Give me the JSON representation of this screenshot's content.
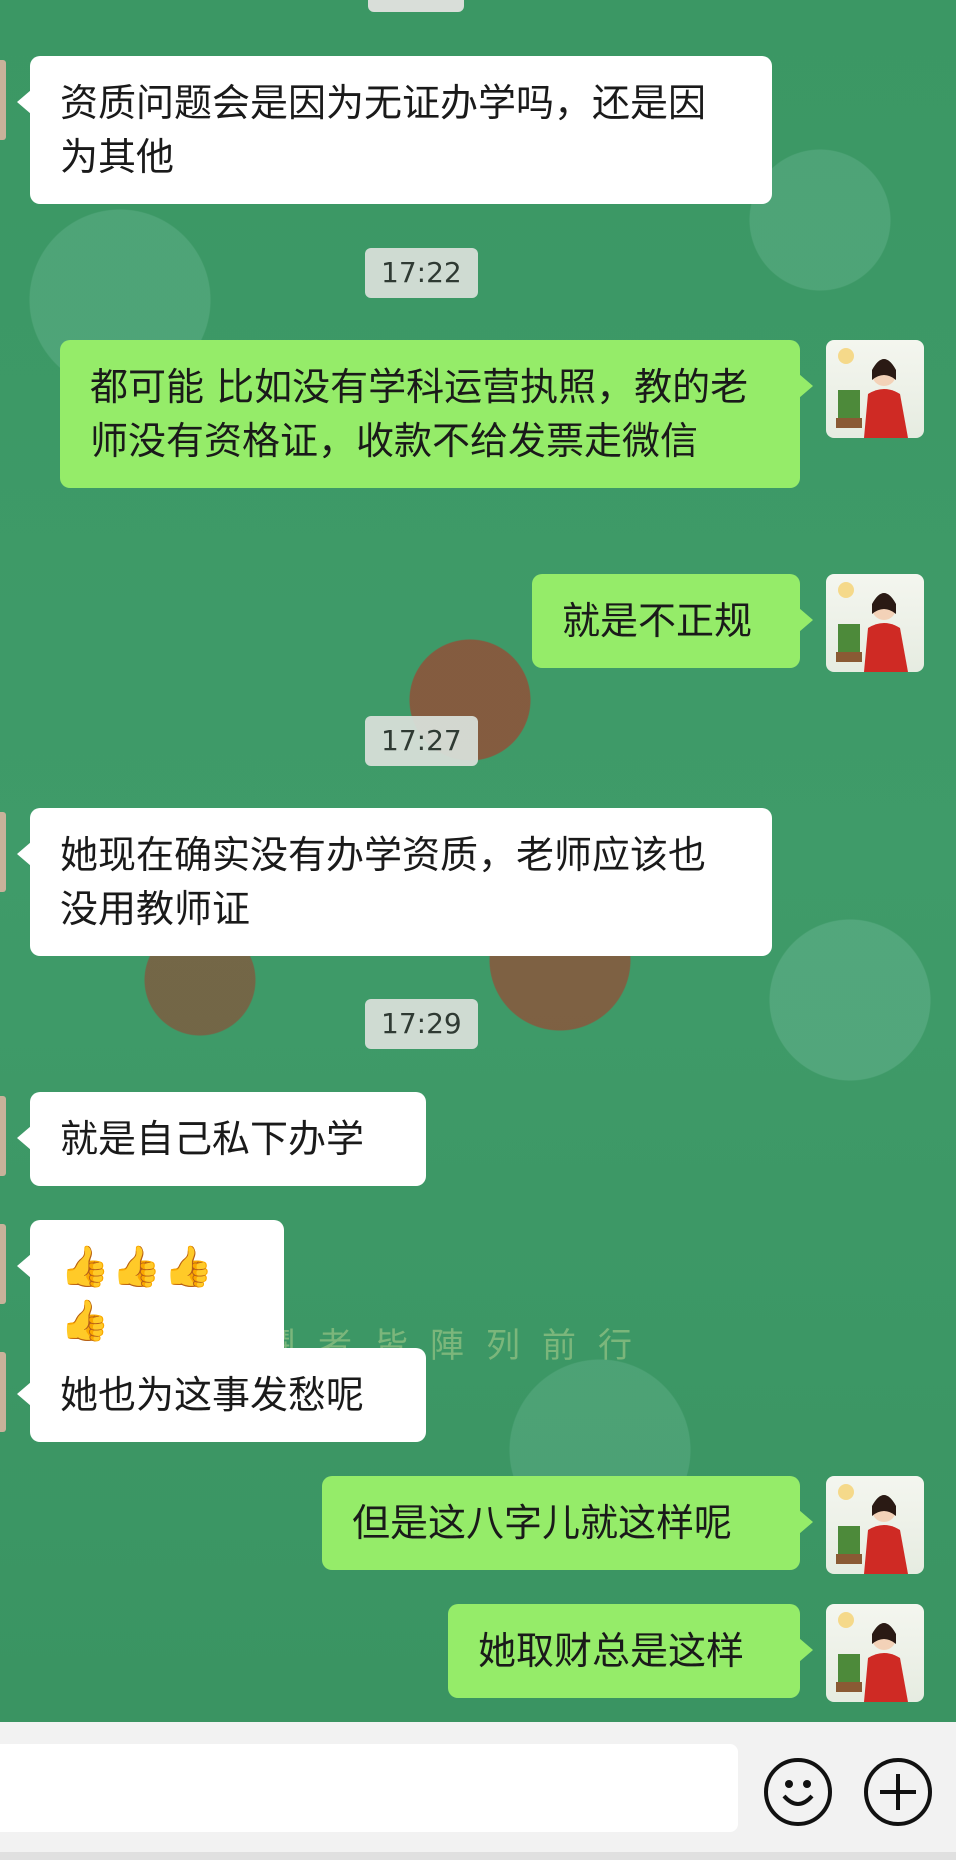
{
  "messages": [
    {
      "side": "left",
      "text": "资质问题会是因为无证办学吗，还是因为其他"
    },
    {
      "time": "17:22"
    },
    {
      "side": "right",
      "text": "都可能  比如没有学科运营执照，教的老师没有资格证，收款不给发票走微信"
    },
    {
      "side": "right",
      "text": "就是不正规"
    },
    {
      "time": "17:27"
    },
    {
      "side": "left",
      "text": "她现在确实没有办学资质，老师应该也没用教师证"
    },
    {
      "time": "17:29"
    },
    {
      "side": "left",
      "text": "就是自己私下办学"
    },
    {
      "side": "left",
      "text": "👍👍👍👍"
    },
    {
      "side": "left",
      "text": "她也为这事发愁呢"
    },
    {
      "side": "right",
      "text": "但是这八字儿就这样呢"
    },
    {
      "side": "right",
      "text": "她取财总是这样"
    }
  ],
  "background": {
    "caption": "臨兵鬪者皆陣列前行"
  },
  "icons": {
    "emoji_button": "smiley-icon",
    "more_button": "plus-icon"
  },
  "colors": {
    "chat_bg": "#3f9a68",
    "outgoing_bubble": "#95ec69",
    "incoming_bubble": "#ffffff"
  }
}
